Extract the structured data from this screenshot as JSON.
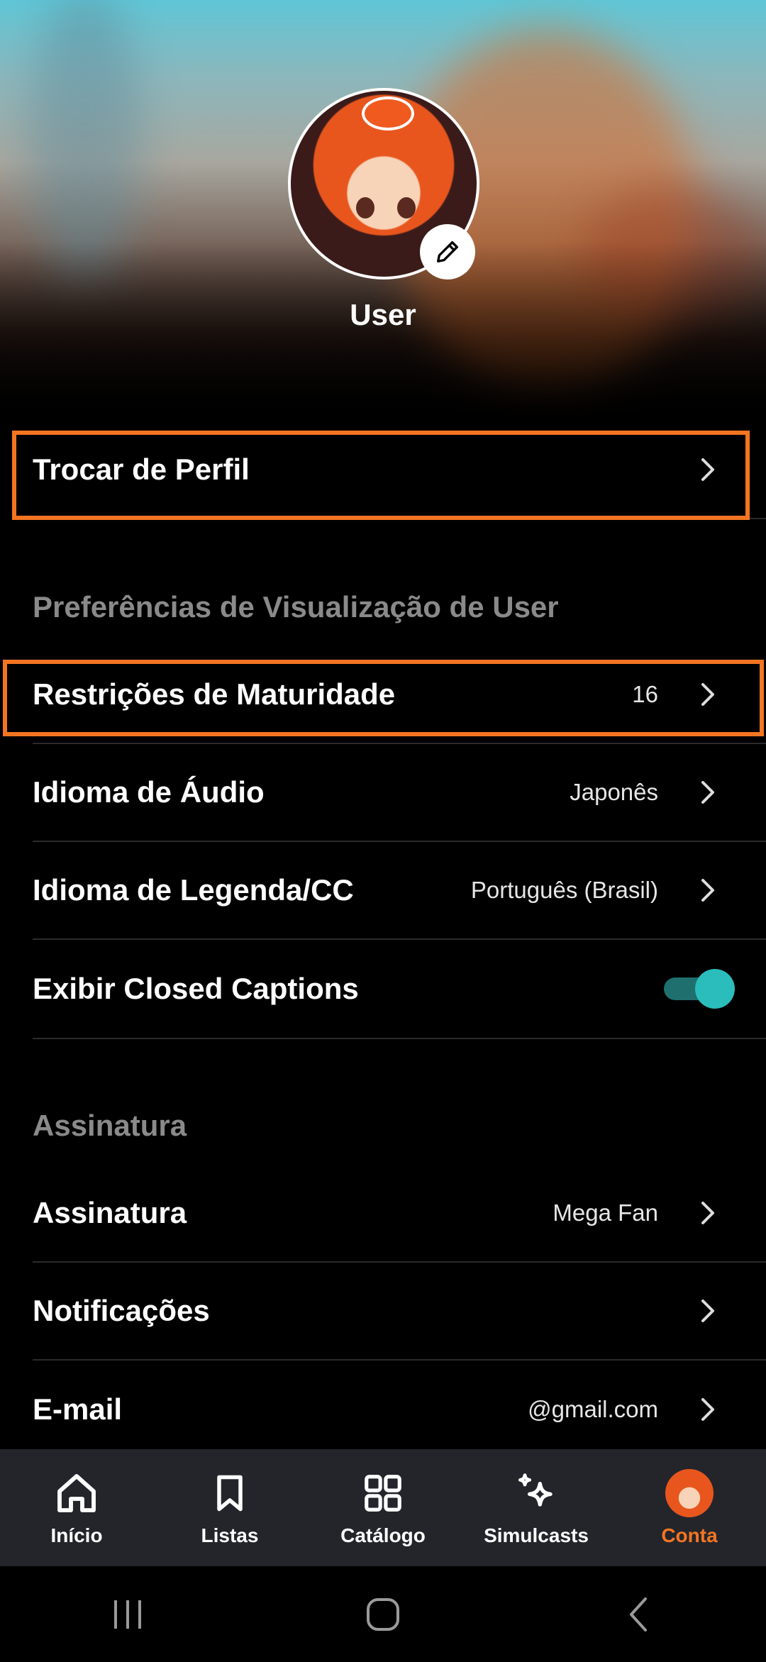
{
  "profile": {
    "username": "User"
  },
  "switch_profile": {
    "label": "Trocar de Perfil"
  },
  "viewing_prefs": {
    "section_title": "Preferências de Visualização de User",
    "rows": [
      {
        "label": "Restrições de Maturidade",
        "value": "16"
      },
      {
        "label": "Idioma de Áudio",
        "value": "Japonês"
      },
      {
        "label": "Idioma de Legenda/CC",
        "value": "Português (Brasil)"
      }
    ],
    "closed_captions": {
      "label": "Exibir Closed Captions",
      "enabled": true
    }
  },
  "subscription": {
    "section_title": "Assinatura",
    "rows": [
      {
        "label": "Assinatura",
        "value": "Mega Fan"
      },
      {
        "label": "Notificações",
        "value": ""
      },
      {
        "label": "E-mail",
        "value": "@gmail.com"
      }
    ]
  },
  "bottom_nav": [
    {
      "label": "Início",
      "icon": "home-icon"
    },
    {
      "label": "Listas",
      "icon": "bookmark-icon"
    },
    {
      "label": "Catálogo",
      "icon": "grid-icon"
    },
    {
      "label": "Simulcasts",
      "icon": "sparkles-icon"
    },
    {
      "label": "Conta",
      "icon": "account-avatar",
      "active": true
    }
  ],
  "colors": {
    "accent": "#f47521",
    "toggle": "#2abdbb",
    "nav_bg": "#23252b"
  }
}
